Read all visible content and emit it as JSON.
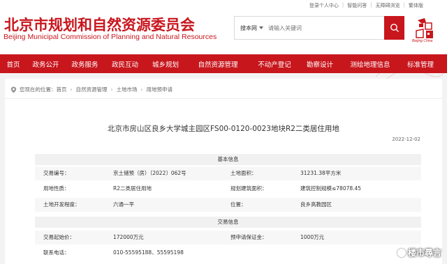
{
  "toplinks": [
    "登录个人中心",
    "智能问答",
    "无障碍浏览",
    "繁体版"
  ],
  "header": {
    "logo_cn": "北京市规划和自然资源委员会",
    "logo_en": "Beijing Municipal Commission of Planning and Natural Resources",
    "emblem_text": "Beijing China"
  },
  "search": {
    "scope": "搜本网",
    "placeholder": "请输入关键词"
  },
  "nav": [
    "首页",
    "政务公开",
    "政务服务",
    "政民互动",
    "城乡规划",
    "自然资源管理",
    "不动产登记",
    "勘察设计",
    "测绘地理信息",
    "标准管理"
  ],
  "breadcrumb": {
    "prefix": "您现在的位置：",
    "items": [
      "首页",
      "自然资源管理",
      "土地市场",
      "用地预申请"
    ]
  },
  "document": {
    "title": "北京市房山区良乡大学城主园区FS00-0120-0023地块R2二类居住用地",
    "date": "2022-12-02"
  },
  "sections": {
    "basic": "基本信息",
    "trade": "交易信息"
  },
  "basic_rows": [
    [
      "交易编号：",
      "京土储预（房）〔2022〕062号",
      "土地面积：",
      "31231.38平方米"
    ],
    [
      "用地性质：",
      "R2二类居住用地",
      "规划建筑面积：",
      "建筑控制规模≤78078.45"
    ],
    [
      "土地开发程度：",
      "六通一平",
      "位置：",
      "良乡高教园区"
    ]
  ],
  "trade_rows": [
    [
      "交易起始价：",
      "172000万元",
      "预申请保证金：",
      "1000万元"
    ],
    [
      "联系电话：",
      "010-55595188、55595198",
      "",
      ""
    ]
  ],
  "watermark": "楼市尋言",
  "colors": {
    "brand_red": "#c8161d",
    "section_bg": "#f1f1f1"
  }
}
